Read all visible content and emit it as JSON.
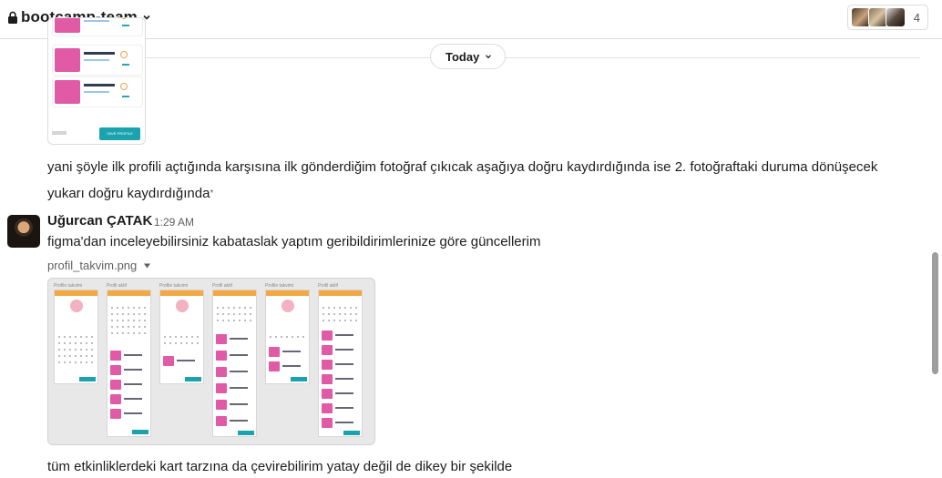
{
  "header": {
    "channel_name": "bootcamp-team",
    "member_count": "4",
    "icons": [
      "lock-icon",
      "chevron-down-icon"
    ]
  },
  "date_divider": {
    "label": "Today"
  },
  "previous_attachment": {
    "save_button": "SAVE PROFILE",
    "sign_out": "Sign Out"
  },
  "messages": {
    "first": {
      "line1": "yani şöyle ilk profili açtığında karşısına ilk gönderdiğim fotoğraf çıkıcak aşağıya doğru kaydırdığında ise 2. fotoğraftaki duruma dönüşecek",
      "line2": "yukarı doğru kaydırdığında",
      "edited_mark": "*"
    },
    "second": {
      "sender": "Uğurcan ÇATAK",
      "time": "1:29 AM",
      "text": "figma'dan inceleyebilirsiniz kabataslak yaptım geribildirimlerinize göre güncellerim",
      "file_name": "profil_takvim.png",
      "followup": "tüm etkinliklerdeki kart tarzına da çevirebilirim yatay değil de dikey bir şekilde"
    }
  },
  "image_frames": [
    "Profile takvimi",
    "Profil aktif",
    "Profile takvimi",
    "Profil aktif",
    "Profile takvimi",
    "Profil aktif"
  ],
  "colors": {
    "accent_pink": "#e05aa6",
    "accent_teal": "#1aa3ae",
    "accent_orange": "#f4a844"
  }
}
